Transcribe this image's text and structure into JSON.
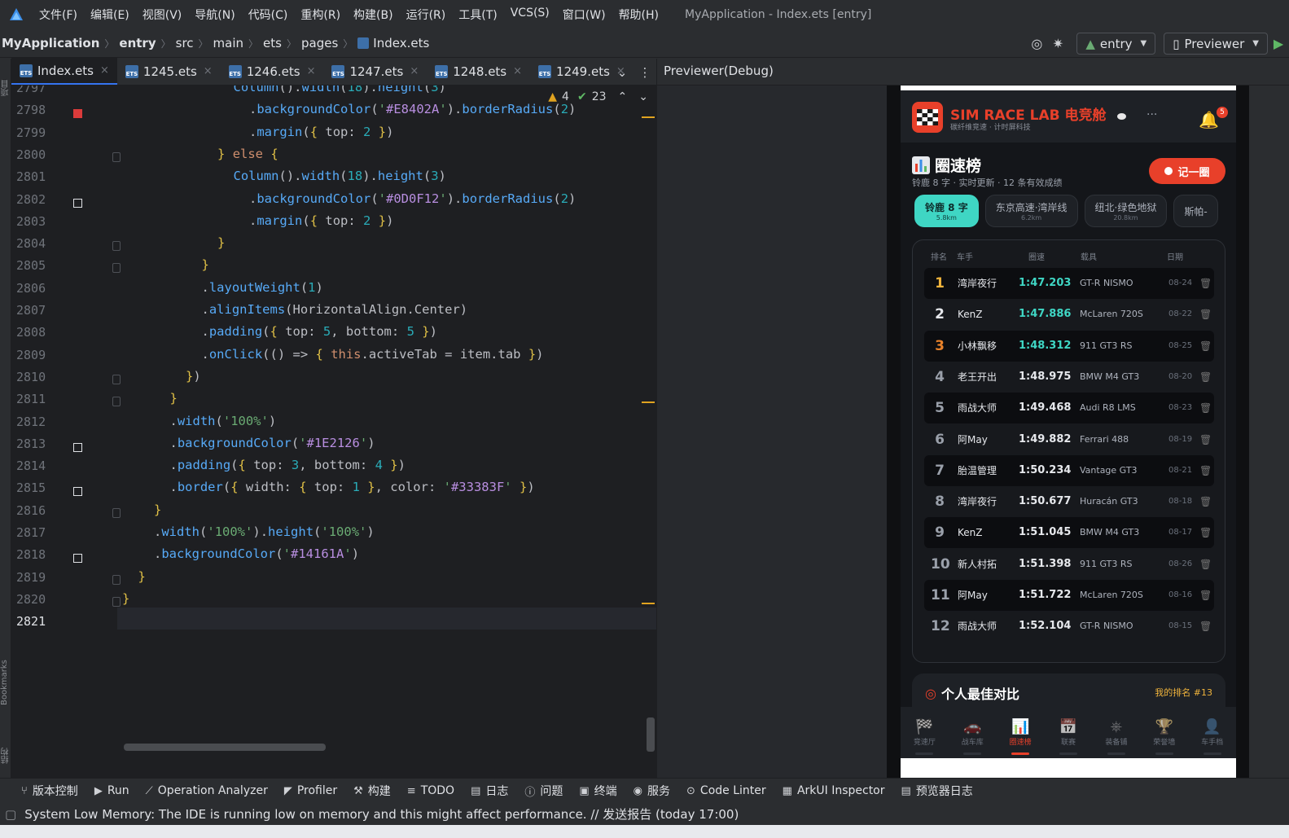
{
  "menubar": {
    "items": [
      "文件(F)",
      "编辑(E)",
      "视图(V)",
      "导航(N)",
      "代码(C)",
      "重构(R)",
      "构建(B)",
      "运行(R)",
      "工具(T)",
      "VCS(S)",
      "窗口(W)",
      "帮助(H)"
    ],
    "window_title": "MyApplication - Index.ets [entry]"
  },
  "breadcrumb": [
    "MyApplication",
    "entry",
    "src",
    "main",
    "ets",
    "pages",
    "Index.ets"
  ],
  "toolbar": {
    "module_select": "entry",
    "preview_select": "Previewer"
  },
  "editor_tabs": [
    "Index.ets",
    "1245.ets",
    "1246.ets",
    "1247.ets",
    "1248.ets",
    "1249.ets"
  ],
  "inspection": {
    "warnings": "4",
    "ok": "23"
  },
  "sidebar_labels": {
    "top": "项目",
    "bookmarks": "Bookmarks",
    "structure": "结构"
  },
  "code": {
    "lines": [
      {
        "n": "2797",
        "text": "Column().width(18).height(3)"
      },
      {
        "n": "2798",
        "text": ".backgroundColor('#E8402A').borderRadius(2)"
      },
      {
        "n": "2799",
        "text": ".margin({ top: 2 })"
      },
      {
        "n": "2800",
        "text": "} else {"
      },
      {
        "n": "2801",
        "text": "Column().width(18).height(3)"
      },
      {
        "n": "2802",
        "text": ".backgroundColor('#0D0F12').borderRadius(2)"
      },
      {
        "n": "2803",
        "text": ".margin({ top: 2 })"
      },
      {
        "n": "2804",
        "text": "}"
      },
      {
        "n": "2805",
        "text": "}"
      },
      {
        "n": "2806",
        "text": ".layoutWeight(1)"
      },
      {
        "n": "2807",
        "text": ".alignItems(HorizontalAlign.Center)"
      },
      {
        "n": "2808",
        "text": ".padding({ top: 5, bottom: 5 })"
      },
      {
        "n": "2809",
        "text": ".onClick(() => { this.activeTab = item.tab })"
      },
      {
        "n": "2810",
        "text": "})"
      },
      {
        "n": "2811",
        "text": "}"
      },
      {
        "n": "2812",
        "text": ".width('100%')"
      },
      {
        "n": "2813",
        "text": ".backgroundColor('#1E2126')"
      },
      {
        "n": "2814",
        "text": ".padding({ top: 3, bottom: 4 })"
      },
      {
        "n": "2815",
        "text": ".border({ width: { top: 1 }, color: '#33383F' })"
      },
      {
        "n": "2816",
        "text": "}"
      },
      {
        "n": "2817",
        "text": ".width('100%').height('100%')"
      },
      {
        "n": "2818",
        "text": ".backgroundColor('#14161A')"
      },
      {
        "n": "2819",
        "text": "}"
      },
      {
        "n": "2820",
        "text": "}"
      },
      {
        "n": "2821",
        "text": ""
      }
    ]
  },
  "previewer": {
    "title": "Previewer(Debug)",
    "app": {
      "brand": "SIM RACE LAB 电竞舱",
      "brand_sub": "碳纤维竞速 · 计时屏科技",
      "more": "···",
      "notification_count": "5",
      "section_title": "圈速榜",
      "section_sub": "铃鹿 8 字 · 实时更新 · 12 条有效成绩",
      "record_button": "记一圈",
      "tracks": [
        {
          "name": "铃鹿 8 字",
          "dist": "5.8km",
          "active": true
        },
        {
          "name": "东京高速·湾岸线",
          "dist": "6.2km",
          "active": false
        },
        {
          "name": "纽北·绿色地狱",
          "dist": "20.8km",
          "active": false
        },
        {
          "name": "斯帕-",
          "dist": "",
          "active": false
        }
      ],
      "table_headers": [
        "排名",
        "车手",
        "圈速",
        "载具",
        "日期"
      ],
      "rows": [
        {
          "rank": "1",
          "driver": "湾岸夜行",
          "time": "1:47.203",
          "car": "GT-R NISMO",
          "date": "08-24"
        },
        {
          "rank": "2",
          "driver": "KenZ",
          "time": "1:47.886",
          "car": "McLaren 720S",
          "date": "08-22"
        },
        {
          "rank": "3",
          "driver": "小林飘移",
          "time": "1:48.312",
          "car": "911 GT3 RS",
          "date": "08-25"
        },
        {
          "rank": "4",
          "driver": "老王开出",
          "time": "1:48.975",
          "car": "BMW M4 GT3",
          "date": "08-20"
        },
        {
          "rank": "5",
          "driver": "雨战大师",
          "time": "1:49.468",
          "car": "Audi R8 LMS",
          "date": "08-23"
        },
        {
          "rank": "6",
          "driver": "阿May",
          "time": "1:49.882",
          "car": "Ferrari 488",
          "date": "08-19"
        },
        {
          "rank": "7",
          "driver": "胎温管理",
          "time": "1:50.234",
          "car": "Vantage GT3",
          "date": "08-21"
        },
        {
          "rank": "8",
          "driver": "湾岸夜行",
          "time": "1:50.677",
          "car": "Huracán GT3",
          "date": "08-18"
        },
        {
          "rank": "9",
          "driver": "KenZ",
          "time": "1:51.045",
          "car": "BMW M4 GT3",
          "date": "08-17"
        },
        {
          "rank": "10",
          "driver": "新人村拓",
          "time": "1:51.398",
          "car": "911 GT3 RS",
          "date": "08-26"
        },
        {
          "rank": "11",
          "driver": "阿May",
          "time": "1:51.722",
          "car": "McLaren 720S",
          "date": "08-16"
        },
        {
          "rank": "12",
          "driver": "雨战大师",
          "time": "1:52.104",
          "car": "GT-R NISMO",
          "date": "08-15"
        }
      ],
      "compare_title": "个人最佳对比",
      "my_rank": "我的排名 #13",
      "tabbar": [
        {
          "label": "竞速厅",
          "icon": "checkered-flag-icon",
          "active": false
        },
        {
          "label": "战车库",
          "icon": "car-icon",
          "active": false
        },
        {
          "label": "圈速榜",
          "icon": "bar-chart-icon",
          "active": true
        },
        {
          "label": "联赛",
          "icon": "calendar-icon",
          "active": false
        },
        {
          "label": "装备铺",
          "icon": "steering-wheel-icon",
          "active": false
        },
        {
          "label": "荣誉墙",
          "icon": "trophy-icon",
          "active": false
        },
        {
          "label": "车手档",
          "icon": "user-icon",
          "active": false
        }
      ]
    }
  },
  "bottom_tools": [
    {
      "label": "版本控制",
      "icon": "vcs-icon"
    },
    {
      "label": "Run",
      "icon": "run-icon"
    },
    {
      "label": "Operation Analyzer",
      "icon": "analyzer-icon"
    },
    {
      "label": "Profiler",
      "icon": "profiler-icon"
    },
    {
      "label": "构建",
      "icon": "hammer-icon"
    },
    {
      "label": "TODO",
      "icon": "list-icon"
    },
    {
      "label": "日志",
      "icon": "log-icon"
    },
    {
      "label": "问题",
      "icon": "problems-icon"
    },
    {
      "label": "终端",
      "icon": "terminal-icon"
    },
    {
      "label": "服务",
      "icon": "services-icon"
    },
    {
      "label": "Code Linter",
      "icon": "linter-icon"
    },
    {
      "label": "ArkUI Inspector",
      "icon": "inspector-icon"
    },
    {
      "label": "预览器日志",
      "icon": "preview-log-icon"
    }
  ],
  "status": {
    "message": "System Low Memory: The IDE is running low on memory and this might affect performance. // 发送报告 (today 17:00)"
  },
  "colors": {
    "accent": "#E8402A",
    "teal": "#3FD6C4",
    "gold": "#F0B43C",
    "editor_bg": "#1E1F22"
  }
}
